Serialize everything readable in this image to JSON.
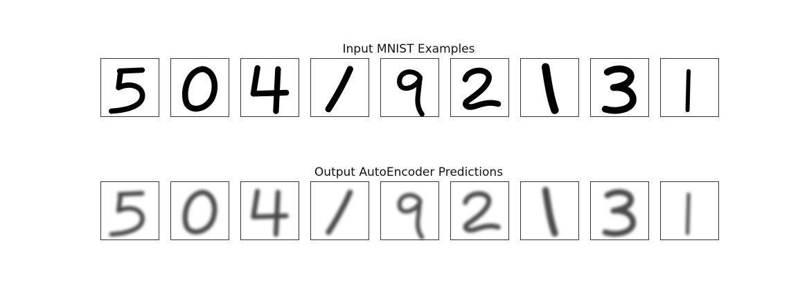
{
  "chart_data": {
    "type": "image-grid",
    "rows": [
      {
        "title": "Input MNIST Examples",
        "style": "sharp",
        "digits": [
          "5",
          "0",
          "4",
          "1",
          "9",
          "2",
          "1",
          "3",
          "1"
        ]
      },
      {
        "title": "Output AutoEncoder Predictions",
        "style": "blurred",
        "digits": [
          "5",
          "0",
          "4",
          "1",
          "9",
          "2",
          "1",
          "3",
          "1"
        ]
      }
    ],
    "colors": {
      "ink": "#000000",
      "ink_soft": "#2a2a2a",
      "background": "#ffffff",
      "frame": "#333333"
    }
  }
}
